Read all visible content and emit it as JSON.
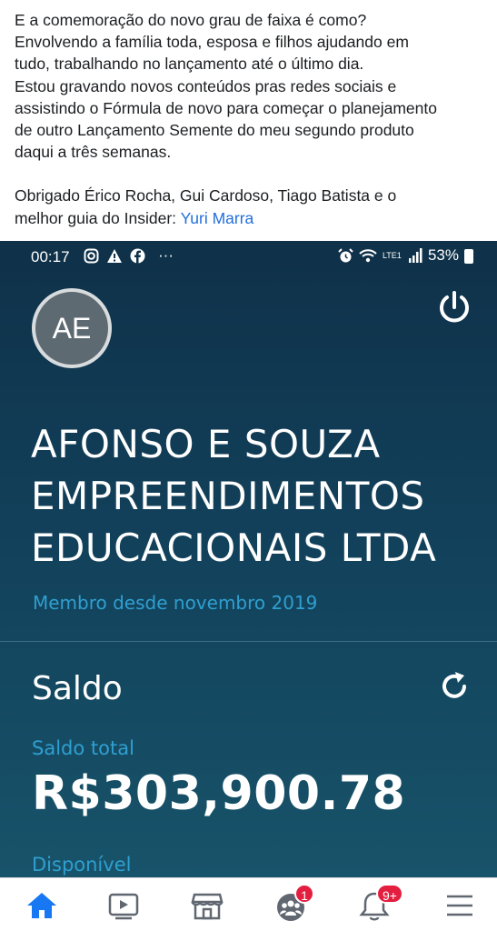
{
  "post": {
    "paragraph1": [
      "E a comemoração do novo grau de faixa é como?",
      "Envolvendo a família toda, esposa e filhos ajudando em",
      "tudo, trabalhando no lançamento até o último dia.",
      "Estou gravando novos conteúdos pras redes sociais e",
      "assistindo o Fórmula de novo para começar o planejamento",
      "de outro Lançamento Semente do meu segundo produto",
      "daqui a três semanas."
    ],
    "thanks_line1": "Obrigado Érico Rocha, Gui Cardoso, Tiago Batista e o",
    "thanks_line2": "melhor guia do Insider: ",
    "mention": "Yuri Marra"
  },
  "screenshot": {
    "status_bar": {
      "time": "00:17",
      "more": "···",
      "network": "LTE1",
      "battery": "53%",
      "left_icons": [
        "instagram-icon",
        "warning-icon",
        "facebook-icon"
      ],
      "right_icons": [
        "alarm-icon",
        "wifi-icon",
        "signal-icon",
        "battery-icon"
      ]
    },
    "avatar_initials": "AE",
    "company_name": [
      "AFONSO E SOUZA",
      "EMPREENDIMENTOS",
      "EDUCACIONAIS LTDA"
    ],
    "member_since": "Membro desde novembro 2019",
    "saldo_title": "Saldo",
    "saldo_total_label": "Saldo total",
    "saldo_total_value": "R$303,900.78",
    "disponivel_label": "Disponível",
    "colors": {
      "background_top": "#0f3149",
      "background_bottom": "#17536a",
      "accent": "#2f9fd0",
      "text": "#ffffff"
    }
  },
  "bottom_nav": {
    "items": [
      {
        "name": "home-icon",
        "active": true
      },
      {
        "name": "watch-icon"
      },
      {
        "name": "marketplace-icon"
      },
      {
        "name": "groups-icon",
        "badge": "1"
      },
      {
        "name": "notifications-icon",
        "badge": "9+"
      },
      {
        "name": "menu-icon"
      }
    ],
    "accent": "#1877f2",
    "badge_color": "#e41e3f"
  }
}
